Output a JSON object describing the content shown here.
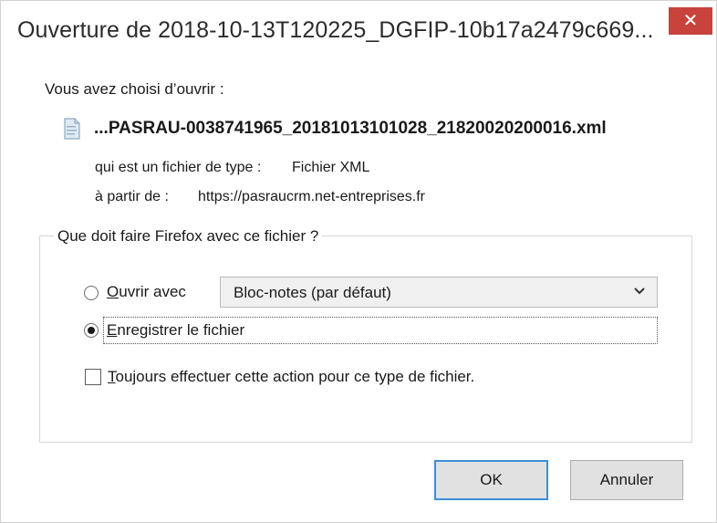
{
  "dialog": {
    "title": "Ouverture de 2018-10-13T120225_DGFIP-10b17a2479c669...",
    "close_glyph": "✕",
    "close_color": "#c7433b",
    "intro": "Vous avez choisi d’ouvrir :",
    "file": {
      "icon": "xml-file-icon",
      "name": "...PASRAU-0038741965_20181013101028_21820020200016.xml",
      "type_label": "qui est un fichier de type :",
      "type_value": "Fichier XML",
      "from_label": "à partir de :",
      "from_value": "https://pasraucrm.net-entreprises.fr"
    },
    "action_group": {
      "legend": "Que doit faire Firefox avec ce fichier ?",
      "open_with": {
        "label_underlined": "O",
        "label_rest": "uvrir avec",
        "selected": false,
        "app_select_value": "Bloc-notes (par défaut)"
      },
      "save_file": {
        "label_underlined": "E",
        "label_rest": "nregistrer le fichier",
        "selected": true
      },
      "always_action": {
        "label_underlined": "T",
        "label_rest": "oujours effectuer cette action pour ce type de fichier.",
        "checked": false
      }
    },
    "buttons": {
      "ok": "OK",
      "cancel": "Annuler",
      "ok_border_color": "#3c8ed6"
    }
  }
}
